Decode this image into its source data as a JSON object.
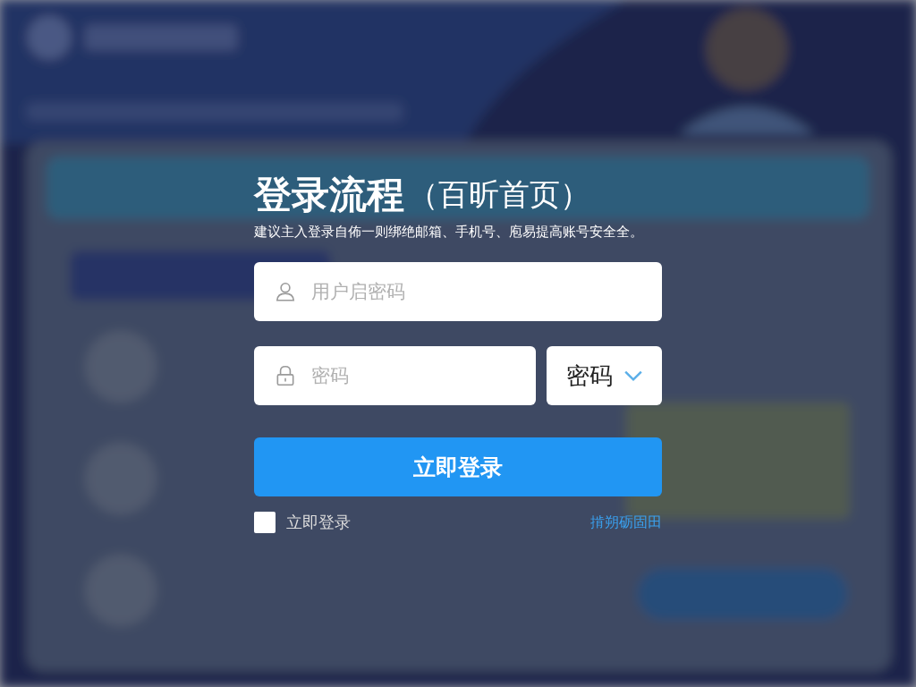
{
  "title": "登录流程",
  "title_note": "（百昕首页）",
  "subtitle": "建议主入登录自佈一则绑绝邮箱、手机号、庖易提高账号安全全。",
  "username_field": {
    "placeholder": "用户启密码"
  },
  "password_field": {
    "placeholder": "密码"
  },
  "type_select": {
    "value": "密码"
  },
  "login_button": {
    "label": "立即登录"
  },
  "remember": {
    "label": "立即登录",
    "checked": false
  },
  "link": {
    "label": "掯朔砺固田"
  }
}
